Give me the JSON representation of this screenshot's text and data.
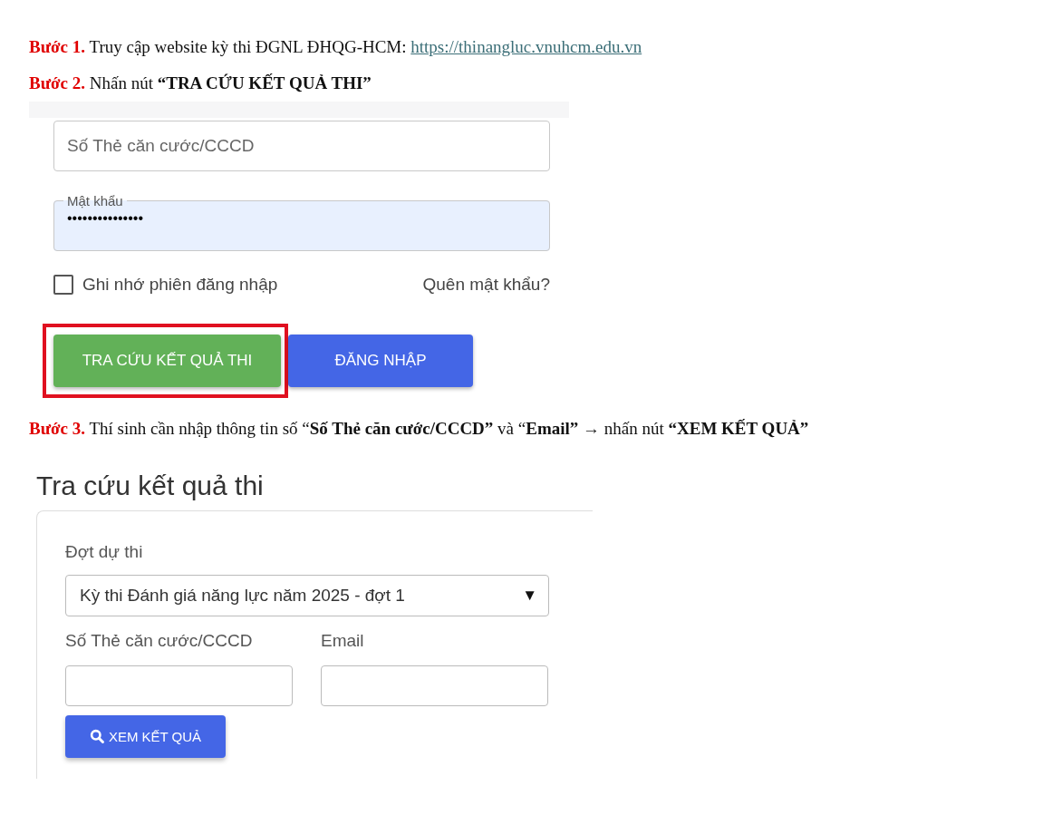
{
  "steps": [
    {
      "label": "Bước 1.",
      "text": "Truy cập website kỳ thi ĐGNL ĐHQG-HCM: ",
      "link": "https://thinangluc.vnuhcm.edu.vn"
    },
    {
      "label": "Bước 2.",
      "text": "Nhấn nút **“TRA CỨU KẾT QUẢ THI”**"
    },
    {
      "label": "Bước 3.",
      "text": "Thí sinh cần nhập thông tin số “**Số Thẻ căn cước/CCCD”** và “**Email”** → nhấn nút **“XEM KẾT QUẢ”**"
    }
  ],
  "login_form": {
    "id_field": {
      "placeholder": "Số Thẻ căn cước/CCCD"
    },
    "password_field": {
      "label": "Mật khẩu",
      "value": "•••••••••••••••"
    },
    "remember": {
      "label": "Ghi nhớ phiên đăng nhập",
      "checked": false
    },
    "forgot_link": "Quên mật khẩu?",
    "buttons": [
      {
        "label": "TRA CỨU KẾT QUẢ THI",
        "kind": "lookup",
        "highlighted": true
      },
      {
        "label": "ĐĂNG NHẬP",
        "kind": "login",
        "highlighted": false
      }
    ]
  },
  "lookup_form": {
    "title": "Tra cứu kết quả thi",
    "round": {
      "label": "Đợt dự thi",
      "value": "Kỳ thi Đánh giá năng lực năm 2025 - đợt 1",
      "caret": "▼"
    },
    "fields": [
      {
        "label": "Số Thẻ căn cước/CCCD"
      },
      {
        "label": "Email"
      }
    ],
    "submit": "XEM KẾT QUẢ"
  }
}
